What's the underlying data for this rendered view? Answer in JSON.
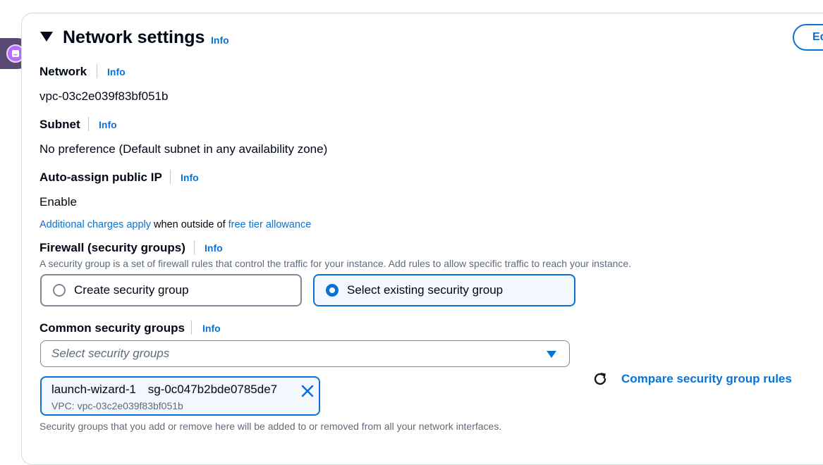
{
  "section": {
    "title": "Network settings",
    "info": "Info",
    "edit_label": "Ed"
  },
  "network": {
    "label": "Network",
    "info": "Info",
    "value": "vpc-03c2e039f83bf051b"
  },
  "subnet": {
    "label": "Subnet",
    "info": "Info",
    "value": "No preference (Default subnet in any availability zone)"
  },
  "public_ip": {
    "label": "Auto-assign public IP",
    "info": "Info",
    "value": "Enable",
    "note_link1": "Additional charges apply",
    "note_text": " when outside of ",
    "note_link2": "free tier allowance"
  },
  "firewall": {
    "label": "Firewall (security groups)",
    "info": "Info",
    "description": "A security group is a set of firewall rules that control the traffic for your instance. Add rules to allow specific traffic to reach your instance.",
    "options": [
      {
        "label": "Create security group",
        "selected": false
      },
      {
        "label": "Select existing security group",
        "selected": true
      }
    ]
  },
  "common_groups": {
    "label": "Common security groups",
    "info": "Info",
    "placeholder": "Select security groups",
    "token": {
      "name": "launch-wizard-1",
      "id": "sg-0c047b2bde0785de7",
      "vpc": "VPC: vpc-03c2e039f83bf051b"
    },
    "compare_label": "Compare security group rules",
    "footer": "Security groups that you add or remove here will be added to or removed from all your network interfaces."
  },
  "colors": {
    "accent": "#0972d3",
    "text": "#000716",
    "muted": "#5f6b7a",
    "selected_bg": "#f2f8fd"
  },
  "icons": [
    "caret-down-icon",
    "radio-icon",
    "dropdown-caret-icon",
    "close-icon",
    "refresh-icon",
    "extension-icon"
  ]
}
